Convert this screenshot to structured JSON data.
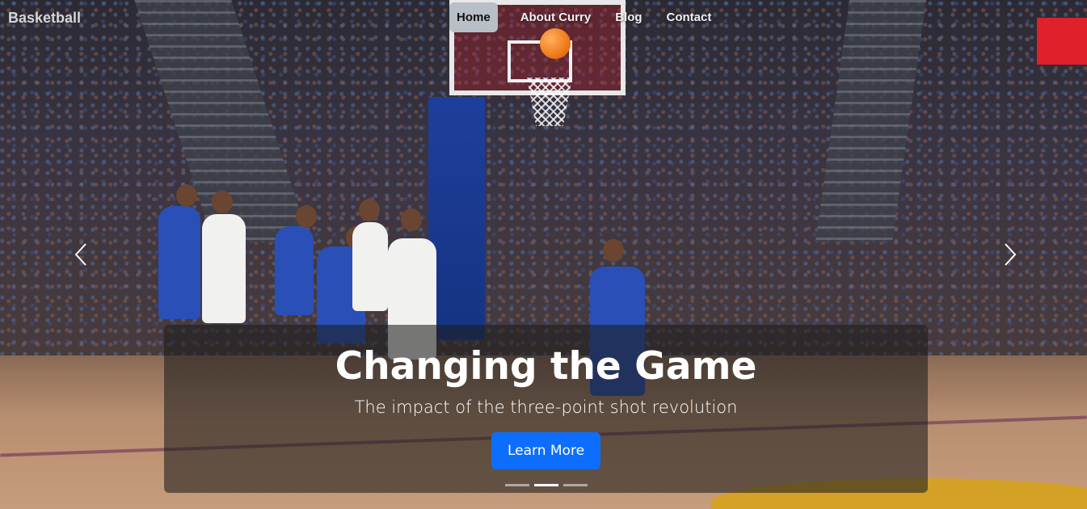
{
  "brand": "Basketball",
  "nav": {
    "items": [
      {
        "label": "Home",
        "active": true
      },
      {
        "label": "About Curry",
        "active": false
      },
      {
        "label": "Blog",
        "active": false
      },
      {
        "label": "Contact",
        "active": false
      }
    ]
  },
  "hero": {
    "image": "basketball-arena-photo",
    "title": "Changing the Game",
    "subtitle": "The impact of the three-point shot revolution",
    "button_label": "Learn More",
    "prev_icon": "chevron-left-icon",
    "next_icon": "chevron-right-icon",
    "slide_count": 3,
    "active_slide": 2
  },
  "colors": {
    "accent": "#0d6efd",
    "nav_active_bg": "#b8bfc6",
    "caption_bg": "rgba(30,30,30,0.58)"
  }
}
